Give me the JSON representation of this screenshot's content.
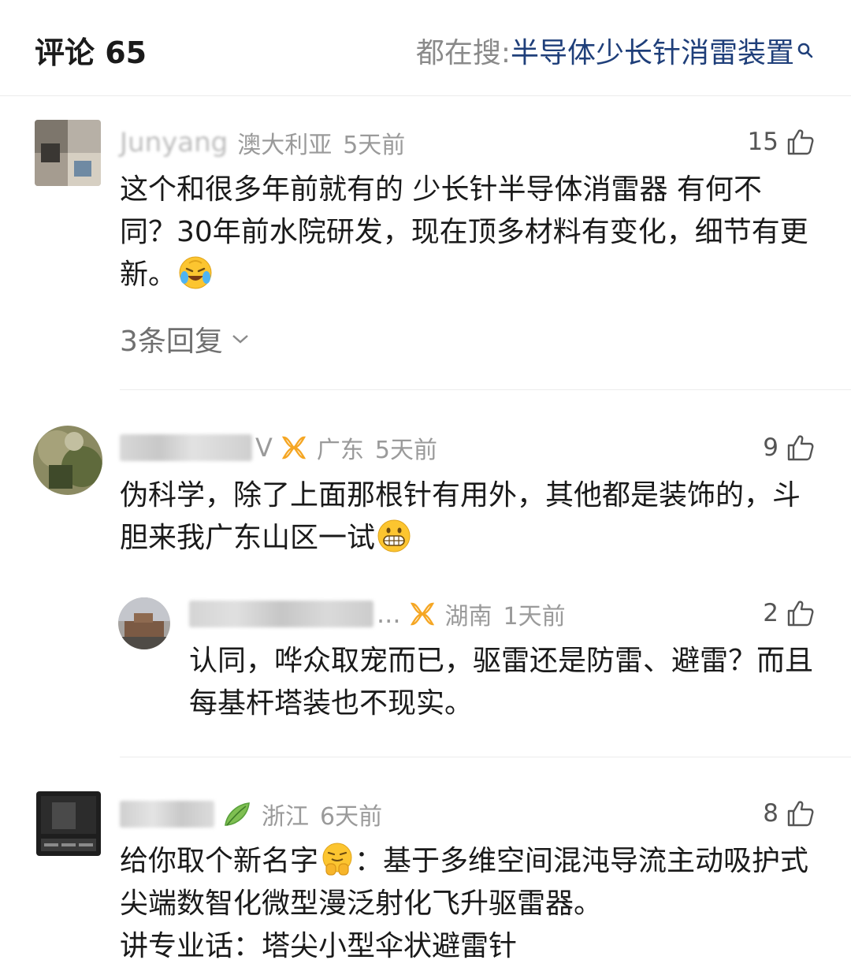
{
  "header": {
    "title": "评论 65",
    "search_prefix": "都在搜: ",
    "search_term": "半导体少长针消雷装置"
  },
  "comments": [
    {
      "user": "Junyang",
      "location": "澳大利亚",
      "time": "5天前",
      "likes": "15",
      "text": "这个和很多年前就有的 少长针半导体消雷器 有何不同？30年前水院研发，现在顶多材料有变化，细节有更新。",
      "replies_label": "3条回复"
    },
    {
      "user_tail": "V",
      "location": "广东",
      "time": "5天前",
      "likes": "9",
      "text": "伪科学，除了上面那根针有用外，其他都是装饰的，斗胆来我广东山区一试"
    },
    {
      "user_tail": "...",
      "location": "湖南",
      "time": "1天前",
      "likes": "2",
      "text": "认同，哗众取宠而已，驱雷还是防雷、避雷？而且每基杆塔装也不现实。"
    },
    {
      "location": "浙江",
      "time": "6天前",
      "likes": "8",
      "text_a": "给你取个新名字",
      "text_b": "：基于多维空间混沌导流主动吸护式尖端数智化微型漫泛射化飞升驱雷器。",
      "text_c": "讲专业话：塔尖小型伞状避雷针"
    }
  ],
  "colors": {
    "accent_link": "#1f3f7a",
    "meta_gray": "#9a9a9a",
    "badge_orange": "#f5a623",
    "leaf_green": "#5aa13c"
  },
  "icons": [
    "search-icon",
    "thumbs-up-icon",
    "chevron-down-icon",
    "vip-badge-icon",
    "leaf-badge-icon"
  ]
}
